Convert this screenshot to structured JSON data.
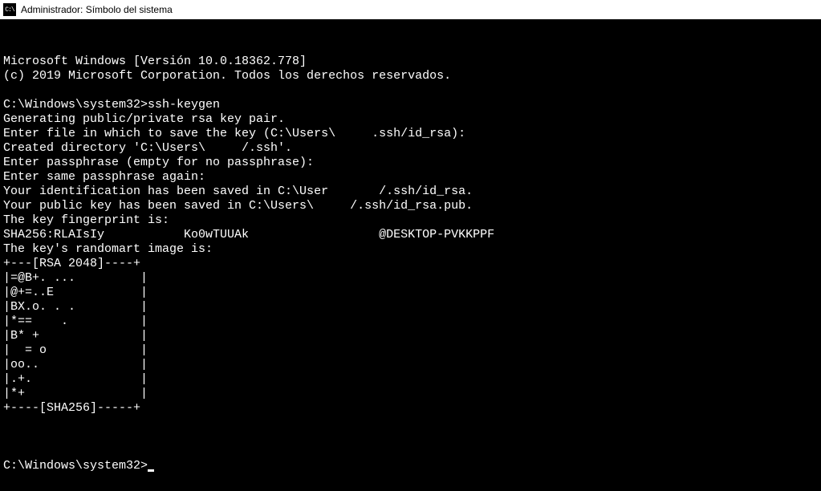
{
  "titlebar": {
    "icon_label": "C:\\",
    "title": "Administrador: Símbolo del sistema"
  },
  "terminal": {
    "lines": [
      "Microsoft Windows [Versión 10.0.18362.778]",
      "(c) 2019 Microsoft Corporation. Todos los derechos reservados.",
      "",
      "C:\\Windows\\system32>ssh-keygen",
      "Generating public/private rsa key pair.",
      "Enter file in which to save the key (C:\\Users\\     .ssh/id_rsa):",
      "Created directory 'C:\\Users\\     /.ssh'.",
      "Enter passphrase (empty for no passphrase):",
      "Enter same passphrase again:",
      "Your identification has been saved in C:\\User       /.ssh/id_rsa.",
      "Your public key has been saved in C:\\Users\\     /.ssh/id_rsa.pub.",
      "The key fingerprint is:",
      "SHA256:RLAIsIy           Ko0wTUUAk                  @DESKTOP-PVKKPPF",
      "The key's randomart image is:",
      "+---[RSA 2048]----+",
      "|=@B+. ...         |",
      "|@+=..E            |",
      "|BX.o. . .         |",
      "|*==    .          |",
      "|B* +              |",
      "|  = o             |",
      "|oo..              |",
      "|.+.               |",
      "|*+                |",
      "+----[SHA256]-----+",
      ""
    ],
    "prompt": "C:\\Windows\\system32>"
  }
}
